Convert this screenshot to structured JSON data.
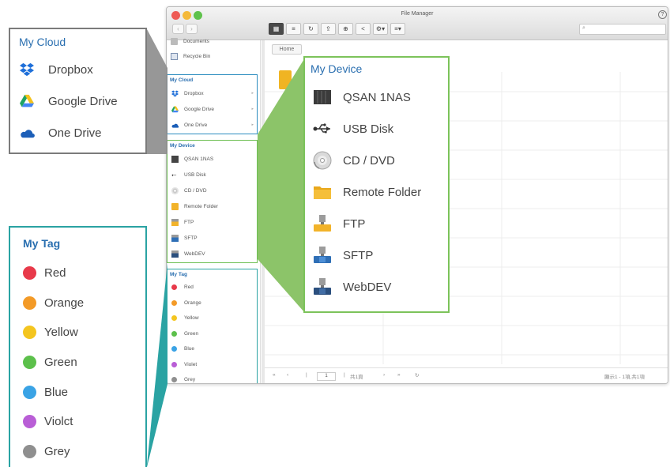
{
  "window": {
    "title": "File Manager",
    "help_glyph": "?",
    "back_glyph": "‹",
    "forward_glyph": "›"
  },
  "toolbar": {
    "buttons": [
      {
        "name": "grid-view-button",
        "glyph": "▦",
        "active": true
      },
      {
        "name": "list-view-button",
        "glyph": "≡",
        "active": false
      },
      {
        "name": "refresh-button",
        "glyph": "↻",
        "active": false
      },
      {
        "name": "upload-button",
        "glyph": "⇪",
        "active": false
      },
      {
        "name": "new-folder-button",
        "glyph": "⊕",
        "active": false
      },
      {
        "name": "share-button",
        "glyph": "<",
        "active": false
      },
      {
        "name": "settings-button",
        "glyph": "⚙▾",
        "active": false
      },
      {
        "name": "filter-button",
        "glyph": "≡▾",
        "active": false
      }
    ]
  },
  "search": {
    "placeholder": ""
  },
  "sidebar": {
    "top_items": [
      {
        "label": "Documents",
        "icon": "folder-icon"
      },
      {
        "label": "Recycle Bin",
        "icon": "recycle-bin-icon"
      }
    ],
    "cloud": {
      "title": "My Cloud",
      "items": [
        {
          "label": "Dropbox",
          "icon": "dropbox-icon"
        },
        {
          "label": "Google Drive",
          "icon": "google-drive-icon"
        },
        {
          "label": "One Drive",
          "icon": "onedrive-icon"
        }
      ]
    },
    "device": {
      "title": "My Device",
      "items": [
        {
          "label": "QSAN 1NAS",
          "icon": "nas-icon"
        },
        {
          "label": "USB Disk",
          "icon": "usb-icon"
        },
        {
          "label": "CD / DVD",
          "icon": "cd-dvd-icon"
        },
        {
          "label": "Remote Folder",
          "icon": "remote-folder-icon"
        },
        {
          "label": "FTP",
          "icon": "ftp-icon"
        },
        {
          "label": "SFTP",
          "icon": "sftp-icon"
        },
        {
          "label": "WebDEV",
          "icon": "webdav-icon"
        }
      ]
    },
    "tags": {
      "title": "My Tag",
      "items": [
        {
          "label": "Red",
          "color": "#e8394a"
        },
        {
          "label": "Orange",
          "color": "#f39a27"
        },
        {
          "label": "Yellow",
          "color": "#f4c51f"
        },
        {
          "label": "Green",
          "color": "#5cc04b"
        },
        {
          "label": "Blue",
          "color": "#3aa3e5"
        },
        {
          "label": "Violet",
          "color": "#b95ed6"
        },
        {
          "label": "Grey",
          "color": "#8f8f8f"
        }
      ]
    }
  },
  "main": {
    "breadcrumb": "Home"
  },
  "statusbar": {
    "page_value": "1",
    "page_total": "共1頁",
    "right_text": "顯示1 - 1項,共1項"
  },
  "callouts": {
    "cloud": {
      "title": "My Cloud",
      "items": [
        "Dropbox",
        "Google Drive",
        "One Drive"
      ]
    },
    "device": {
      "title": "My Device",
      "items": [
        "QSAN 1NAS",
        "USB Disk",
        "CD / DVD",
        "Remote Folder",
        "FTP",
        "SFTP",
        "WebDEV"
      ]
    },
    "tags": {
      "title": "My Tag",
      "items": [
        "Red",
        "Orange",
        "Yellow",
        "Green",
        "Blue",
        "Violct",
        "Grey"
      ]
    }
  },
  "colors": {
    "accent_blue": "#2a6fb0",
    "cloud_border": "#7b7b7b",
    "device_border": "#7cc35a",
    "tag_border": "#2aa3a3"
  }
}
